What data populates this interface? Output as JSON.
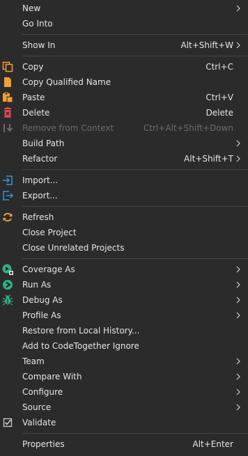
{
  "menu": {
    "items": [
      {
        "label": "New",
        "shortcut": "",
        "submenu": true
      },
      {
        "label": "Go Into",
        "shortcut": ""
      },
      {
        "label": "Show In",
        "shortcut": "Alt+Shift+W",
        "submenu": true
      },
      {
        "label": "Copy",
        "shortcut": "Ctrl+C",
        "icon": "copy-icon"
      },
      {
        "label": "Copy Qualified Name",
        "shortcut": "",
        "icon": "copy-qualified-name-icon"
      },
      {
        "label": "Paste",
        "shortcut": "Ctrl+V",
        "icon": "paste-icon"
      },
      {
        "label": "Delete",
        "shortcut": "Delete",
        "icon": "delete-icon"
      },
      {
        "label": "Remove from Context",
        "shortcut": "Ctrl+Alt+Shift+Down",
        "icon": "remove-from-context-icon",
        "disabled": true
      },
      {
        "label": "Build Path",
        "shortcut": "",
        "submenu": true
      },
      {
        "label": "Refactor",
        "shortcut": "Alt+Shift+T",
        "submenu": true
      },
      {
        "label": "Import...",
        "shortcut": "",
        "icon": "import-icon"
      },
      {
        "label": "Export...",
        "shortcut": "",
        "icon": "export-icon"
      },
      {
        "label": "Refresh",
        "shortcut": "",
        "icon": "refresh-icon"
      },
      {
        "label": "Close Project",
        "shortcut": ""
      },
      {
        "label": "Close Unrelated Projects",
        "shortcut": ""
      },
      {
        "label": "Coverage As",
        "shortcut": "",
        "icon": "coverage-icon",
        "submenu": true
      },
      {
        "label": "Run As",
        "shortcut": "",
        "icon": "run-icon",
        "submenu": true
      },
      {
        "label": "Debug As",
        "shortcut": "",
        "icon": "debug-bug-icon",
        "submenu": true
      },
      {
        "label": "Profile As",
        "shortcut": "",
        "submenu": true
      },
      {
        "label": "Restore from Local History...",
        "shortcut": ""
      },
      {
        "label": "Add to CodeTogether Ignore",
        "shortcut": ""
      },
      {
        "label": "Team",
        "shortcut": "",
        "submenu": true
      },
      {
        "label": "Compare With",
        "shortcut": "",
        "submenu": true
      },
      {
        "label": "Configure",
        "shortcut": "",
        "submenu": true
      },
      {
        "label": "Source",
        "shortcut": "",
        "submenu": true
      },
      {
        "label": "Validate",
        "shortcut": "",
        "icon": "validate-checkbox-icon"
      },
      {
        "label": "Properties",
        "shortcut": "Alt+Enter"
      }
    ]
  },
  "colors": {
    "background": "#2b2b2b",
    "text": "#e6e6e6",
    "disabled_text": "#6c6c6c",
    "separator": "#474747",
    "orange_icon": "#f0a030",
    "red_icon": "#e0474c",
    "blue_icon": "#2e9ad8",
    "green_icon": "#2bb38a"
  }
}
